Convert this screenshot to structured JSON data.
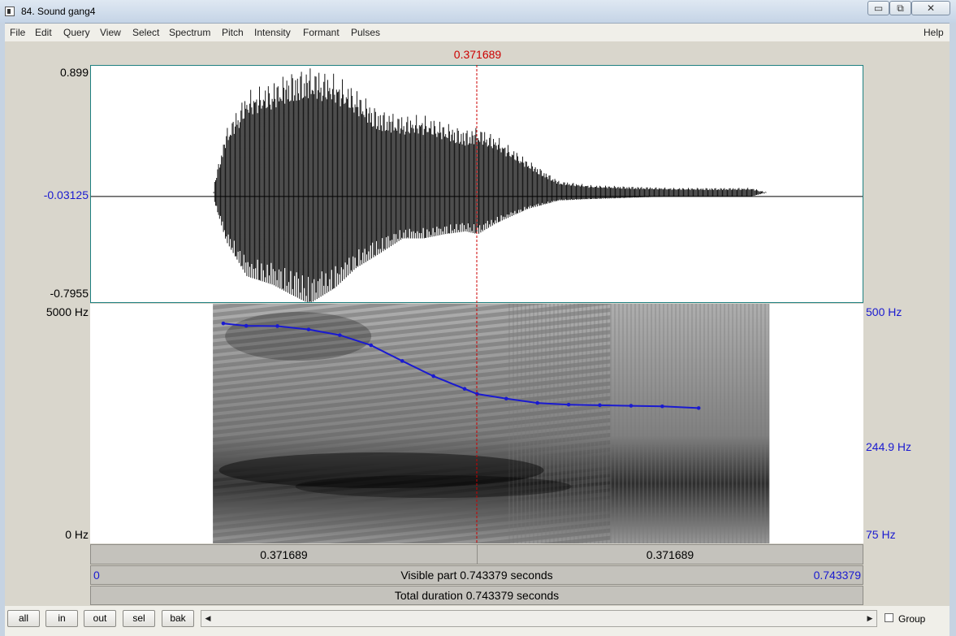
{
  "window": {
    "title": "84. Sound gang4",
    "min_glyph": "▭",
    "max_glyph": "⧉",
    "close_glyph": "✕"
  },
  "menu": {
    "items": [
      "File",
      "Edit",
      "Query",
      "View",
      "Select",
      "Spectrum",
      "Pitch",
      "Intensity",
      "Formant",
      "Pulses"
    ],
    "help": "Help"
  },
  "cursor": {
    "time_label": "0.371689",
    "time": 0.371689
  },
  "waveform": {
    "y_max_label": "0.899",
    "y_mid_label": "-0.03125",
    "y_min_label": "-0.7955"
  },
  "spectrogram": {
    "freq_max_label": "5000 Hz",
    "freq_min_label": "0 Hz"
  },
  "pitch": {
    "max_label": "500 Hz",
    "value_label": "244.9 Hz",
    "min_label": "75 Hz"
  },
  "selection_bar": {
    "left_label": "0.371689",
    "right_label": "0.371689"
  },
  "visible_bar": {
    "start_label": "0",
    "text": "Visible part 0.743379 seconds",
    "end_label": "0.743379"
  },
  "total_bar": {
    "text": "Total duration 0.743379 seconds"
  },
  "buttons": {
    "all": "all",
    "in": "in",
    "out": "out",
    "sel": "sel",
    "bak": "bak"
  },
  "group": {
    "label": "Group",
    "checked": false
  },
  "colors": {
    "cursor": "#cc0000",
    "pitch": "#1a1ad0",
    "axis_blue": "#1a1ad0"
  },
  "chart_data": {
    "type": "line",
    "x_unit": "s",
    "x_range": [
      0,
      0.743379
    ],
    "pitch_range_hz": [
      75,
      500
    ],
    "pitch_series": {
      "x": [
        0.128,
        0.15,
        0.18,
        0.21,
        0.24,
        0.27,
        0.3,
        0.33,
        0.36,
        0.372,
        0.4,
        0.43,
        0.46,
        0.49,
        0.52,
        0.55,
        0.585
      ],
      "y": [
        428,
        420,
        419,
        408,
        390,
        360,
        318,
        282,
        255,
        244.9,
        236,
        228,
        225,
        224,
        223,
        222,
        219
      ]
    },
    "waveform_envelope": {
      "x": [
        0.118,
        0.13,
        0.15,
        0.175,
        0.19,
        0.21,
        0.235,
        0.255,
        0.275,
        0.3,
        0.32,
        0.34,
        0.36,
        0.372,
        0.39,
        0.42,
        0.45,
        0.48,
        0.52,
        0.56,
        0.6,
        0.635,
        0.65
      ],
      "top": [
        0.05,
        0.45,
        0.72,
        0.79,
        0.86,
        0.899,
        0.84,
        0.74,
        0.6,
        0.55,
        0.55,
        0.5,
        0.45,
        0.47,
        0.4,
        0.23,
        0.08,
        0.05,
        0.04,
        0.03,
        0.03,
        0.03,
        0.0
      ],
      "bottom": [
        -0.05,
        -0.35,
        -0.6,
        -0.66,
        -0.72,
        -0.7955,
        -0.68,
        -0.54,
        -0.45,
        -0.33,
        -0.33,
        -0.3,
        -0.28,
        -0.3,
        -0.22,
        -0.12,
        -0.06,
        -0.05,
        -0.04,
        -0.03,
        -0.03,
        -0.03,
        0.0
      ]
    }
  }
}
